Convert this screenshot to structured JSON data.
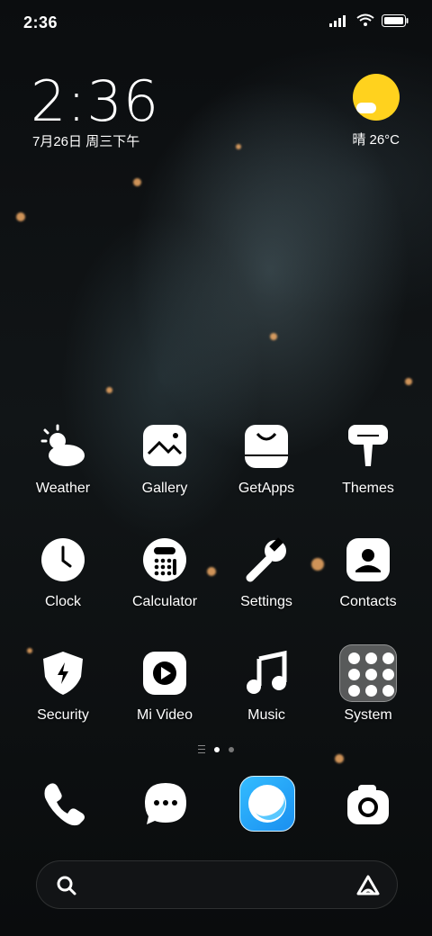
{
  "status_bar": {
    "time": "2:36",
    "icons": [
      "signal-icon",
      "wifi-icon",
      "battery-icon"
    ]
  },
  "clock_widget": {
    "time": "2:36",
    "date": "7月26日 周三下午"
  },
  "weather_widget": {
    "condition_temp": "晴 26°C",
    "icon": "sunny-cloud-icon"
  },
  "apps": [
    {
      "label": "Weather",
      "icon": "weather-icon"
    },
    {
      "label": "Gallery",
      "icon": "gallery-icon"
    },
    {
      "label": "GetApps",
      "icon": "getapps-icon"
    },
    {
      "label": "Themes",
      "icon": "themes-icon"
    },
    {
      "label": "Clock",
      "icon": "clock-icon"
    },
    {
      "label": "Calculator",
      "icon": "calculator-icon"
    },
    {
      "label": "Settings",
      "icon": "wrench-icon"
    },
    {
      "label": "Contacts",
      "icon": "contact-icon"
    },
    {
      "label": "Security",
      "icon": "shield-icon"
    },
    {
      "label": "Mi Video",
      "icon": "play-icon"
    },
    {
      "label": "Music",
      "icon": "music-note-icon"
    },
    {
      "label": "System",
      "icon": "folder-icon"
    }
  ],
  "page_indicator": {
    "pages": 2,
    "current": 1
  },
  "dock": [
    {
      "icon": "phone-icon"
    },
    {
      "icon": "message-icon"
    },
    {
      "icon": "browser-icon"
    },
    {
      "icon": "camera-icon"
    }
  ],
  "search_bar": {
    "left_icon": "search-icon",
    "right_icon": "assistant-icon"
  },
  "colors": {
    "sun": "#ffd21e",
    "browser": "#1a8ff0",
    "bokeh": "#ffb46a"
  }
}
